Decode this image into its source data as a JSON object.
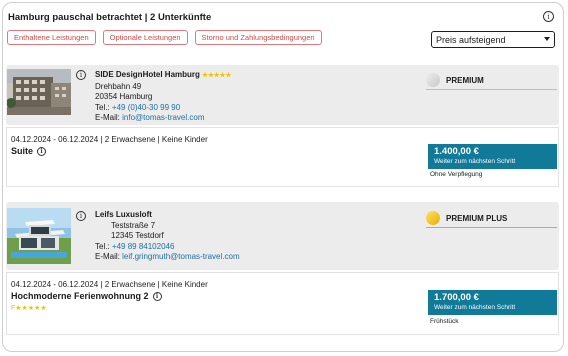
{
  "header": {
    "title": "Hamburg pauschal betrachtet | 2 Unterkünfte"
  },
  "tabs": [
    {
      "label": "Enthaltene Leistungen"
    },
    {
      "label": "Optionale Leistungen"
    },
    {
      "label": "Storno und Zahlungsbedingungen"
    }
  ],
  "sort": {
    "selected": "Preis aufsteigend"
  },
  "hotels": [
    {
      "name": "SIDE DesignHotel Hamburg",
      "stars": "★★★★★",
      "street": "Drehbahn 49",
      "city": "20354 Hamburg",
      "phone_label": "Tel.:",
      "phone": "+49 (0)40-30 99 90",
      "email_label": "E-Mail:",
      "email": "info@tomas-travel.com",
      "badge": "PREMIUM",
      "badge_color": "#d9d9d9",
      "offer": {
        "details": "04.12.2024 - 06.12.2024 | 2 Erwachsene | Keine Kinder",
        "room": "Suite",
        "room_stars": "",
        "price": "1.400,00 €",
        "cta": "Weiter zum nächsten Schritt",
        "board": "Ohne Verpflegung"
      }
    },
    {
      "name": "Leifs Luxusloft",
      "stars": "",
      "street": "Teststraße 7",
      "city": "12345 Testdorf",
      "phone_label": "Tel.:",
      "phone": "+49 89 84102046",
      "email_label": "E-Mail:",
      "email": "leif.gringmuth@tomas-travel.com",
      "badge": "PREMIUM PLUS",
      "badge_color": "#f2c200",
      "offer": {
        "details": "04.12.2024 - 06.12.2024 | 2 Erwachsene | Keine Kinder",
        "room": "Hochmoderne Ferienwohnung 2",
        "room_stars": "F★★★★★",
        "price": "1.700,00 €",
        "cta": "Weiter zum nächsten Schritt",
        "board": "Frühstück"
      }
    }
  ]
}
